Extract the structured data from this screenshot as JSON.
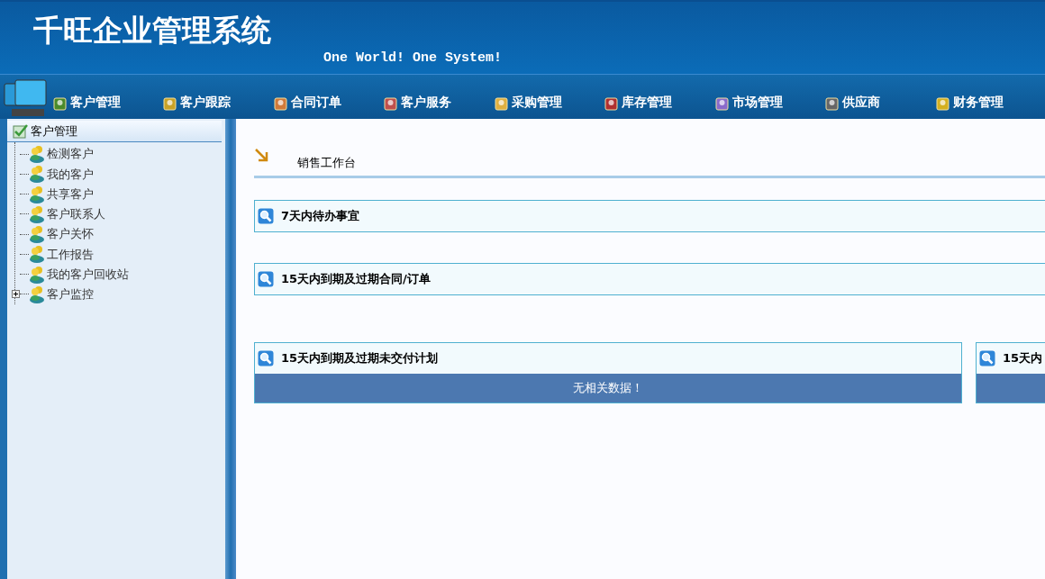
{
  "header": {
    "title": "千旺企业管理系统",
    "slogan": "One World! One System!"
  },
  "nav": [
    {
      "label": "客户管理"
    },
    {
      "label": "客户跟踪"
    },
    {
      "label": "合同订单"
    },
    {
      "label": "客户服务"
    },
    {
      "label": "采购管理"
    },
    {
      "label": "库存管理"
    },
    {
      "label": "市场管理"
    },
    {
      "label": "供应商"
    },
    {
      "label": "财务管理"
    }
  ],
  "sidebar": {
    "title": "客户管理",
    "items": [
      {
        "label": "检测客户",
        "expandable": false
      },
      {
        "label": "我的客户",
        "expandable": false
      },
      {
        "label": "共享客户",
        "expandable": false
      },
      {
        "label": "客户联系人",
        "expandable": false
      },
      {
        "label": "客户关怀",
        "expandable": false
      },
      {
        "label": "工作报告",
        "expandable": false
      },
      {
        "label": "我的客户回收站",
        "expandable": false
      },
      {
        "label": "客户监控",
        "expandable": true
      }
    ]
  },
  "workspace": {
    "title": "销售工作台",
    "rows": [
      [
        {
          "kind": "header",
          "title": "7天内待办事宜"
        }
      ],
      [
        {
          "kind": "header",
          "title": "15天内到期及过期合同/订单"
        }
      ],
      [
        {
          "kind": "table",
          "title": "15天内到期及过期未交付计划",
          "message": "无相关数据！"
        },
        {
          "kind": "table",
          "title": "15天内"
        }
      ]
    ]
  }
}
